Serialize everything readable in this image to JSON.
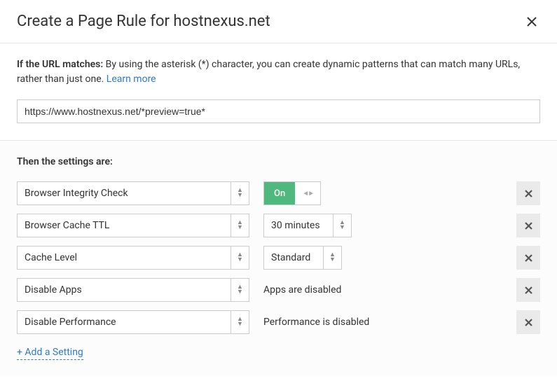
{
  "header": {
    "title": "Create a Page Rule for hostnexus.net"
  },
  "if_section": {
    "label": "If the URL matches:",
    "description": " By using the asterisk (*) character, you can create dynamic patterns that can match many URLs, rather than just one. ",
    "learn_more": "Learn more",
    "url_value": "https://www.hostnexus.net/*preview=true*"
  },
  "then_section": {
    "label": "Then the settings are:",
    "rules": [
      {
        "setting": "Browser Integrity Check",
        "value_type": "toggle",
        "toggle_state": "On"
      },
      {
        "setting": "Browser Cache TTL",
        "value_type": "select",
        "value": "30 minutes"
      },
      {
        "setting": "Cache Level",
        "value_type": "select",
        "value": "Standard"
      },
      {
        "setting": "Disable Apps",
        "value_type": "text",
        "value": "Apps are disabled"
      },
      {
        "setting": "Disable Performance",
        "value_type": "text",
        "value": "Performance is disabled"
      }
    ],
    "add_label": "+ Add a Setting"
  }
}
